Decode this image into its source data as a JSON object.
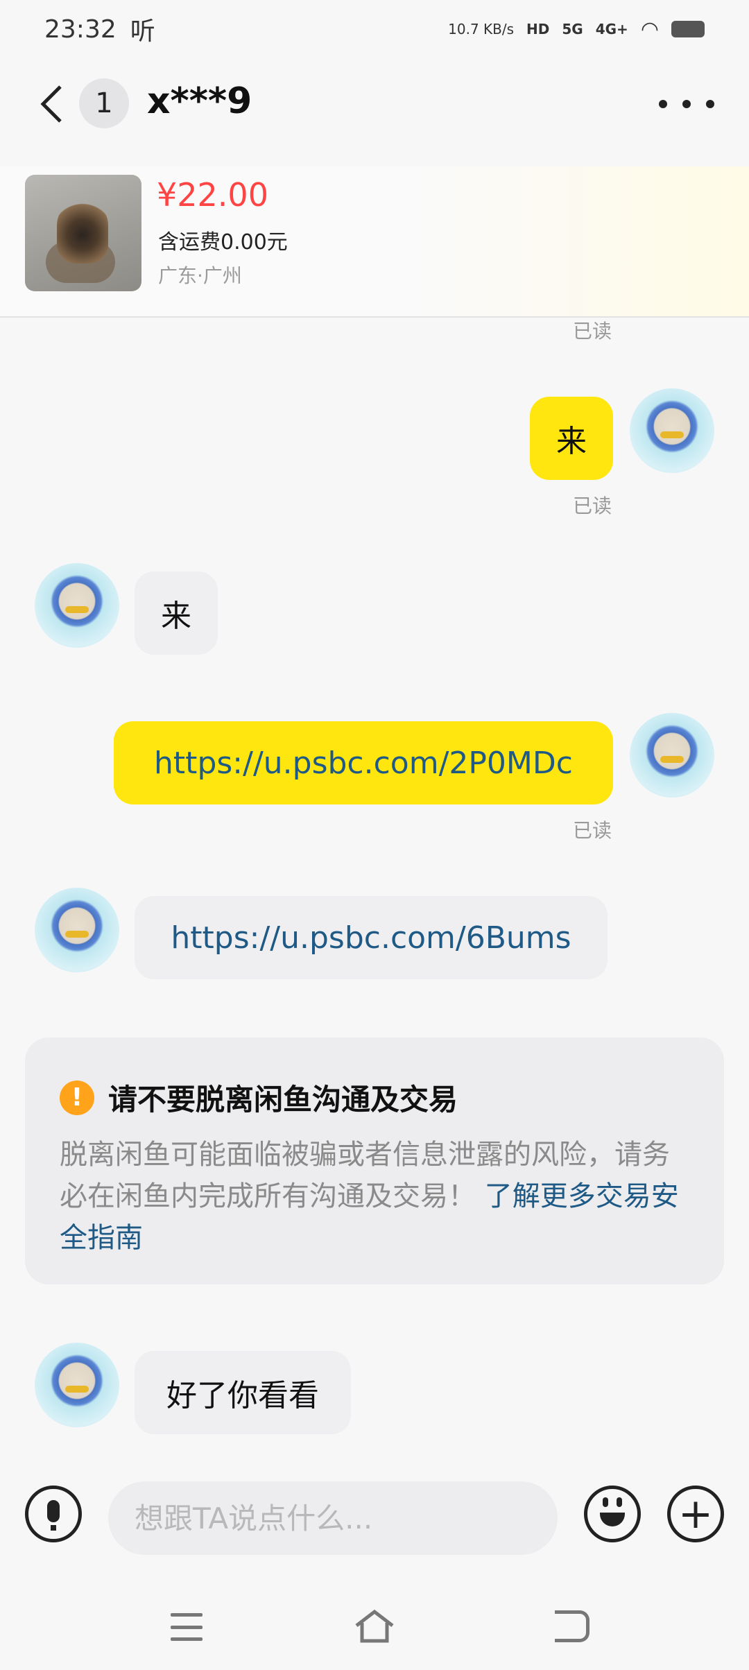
{
  "status_bar": {
    "time": "23:32",
    "carrier_icon_text": "听",
    "speed": "10.7 KB/s",
    "hd_label": "HD",
    "net_5g": "5G",
    "net_4g": "4G+"
  },
  "header": {
    "unread_count": "1",
    "title": "x***9"
  },
  "product": {
    "price": "¥22.00",
    "shipping": "含运费0.00元",
    "location": "广东·广州"
  },
  "messages": [
    {
      "side": "mine",
      "text": "来",
      "status": "已读"
    },
    {
      "side": "theirs",
      "text": "来"
    },
    {
      "side": "mine",
      "text": "https://u.psbc.com/2P0MDc",
      "status": "已读"
    },
    {
      "side": "theirs",
      "text": "https://u.psbc.com/6Bums"
    },
    {
      "side": "theirs",
      "text": "好了你看看"
    }
  ],
  "top_read_status": "已读",
  "warning": {
    "icon": "!",
    "title": "请不要脱离闲鱼沟通及交易",
    "body": "脱离闲鱼可能面临被骗或者信息泄露的风险，请务必在闲鱼内完成所有沟通及交易！",
    "link": "了解更多交易安全指南"
  },
  "input": {
    "placeholder": "想跟TA说点什么..."
  },
  "plus_symbol": "+"
}
